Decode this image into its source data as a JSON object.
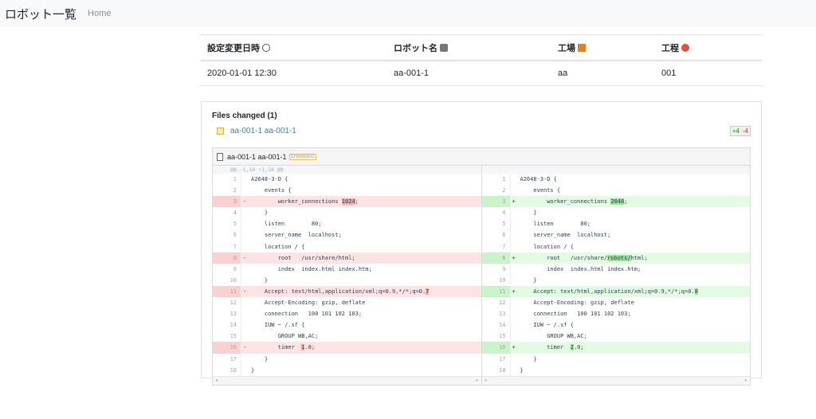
{
  "navbar": {
    "brand": "ロボット一覧",
    "home": "Home"
  },
  "info_table": {
    "headers": [
      {
        "label": "設定変更日時",
        "icon": "clock-icon"
      },
      {
        "label": "ロボット名",
        "icon": "robot-icon"
      },
      {
        "label": "工場",
        "icon": "factory-icon"
      },
      {
        "label": "工程",
        "icon": "warning-icon"
      }
    ],
    "row": [
      "2020-01-01 12:30",
      "aa-001-1",
      "aa",
      "001"
    ]
  },
  "files": {
    "title": "Files changed (1)",
    "file_link": "aa-001-1 aa-001-1",
    "added": "+4",
    "removed": "-4"
  },
  "diff": {
    "file_name": "aa-001-1 aa-001-1",
    "badge": "CHANGED",
    "hunk": "@@ -1,18 +1,18 @@",
    "left": [
      {
        "n": "1",
        "s": "",
        "t": "A2648-3-D {",
        "k": ""
      },
      {
        "n": "2",
        "s": "",
        "t": "    events {",
        "k": ""
      },
      {
        "n": "3",
        "s": "-",
        "t": "        worker_connections ",
        "h": "1024",
        "r": ";",
        "k": "del"
      },
      {
        "n": "4",
        "s": "",
        "t": "    }",
        "k": ""
      },
      {
        "n": "5",
        "s": "",
        "t": "    listen        80;",
        "k": ""
      },
      {
        "n": "6",
        "s": "",
        "t": "    server_name  localhost;",
        "k": ""
      },
      {
        "n": "7",
        "s": "",
        "t": "    location / {",
        "k": ""
      },
      {
        "n": "8",
        "s": "-",
        "t": "        root   /usr/share/html;",
        "k": "del"
      },
      {
        "n": "9",
        "s": "",
        "t": "        index  index.html index.htm;",
        "k": ""
      },
      {
        "n": "10",
        "s": "",
        "t": "    }",
        "k": ""
      },
      {
        "n": "11",
        "s": "-",
        "t": "    Accept: text/html,application/xml;q=0.9,*/*;q=0.",
        "h": "7",
        "r": "",
        "k": "del"
      },
      {
        "n": "12",
        "s": "",
        "t": "    Accept-Encoding: gzip, deflate",
        "k": ""
      },
      {
        "n": "13",
        "s": "",
        "t": "    connection   100 101 102 103;",
        "k": ""
      },
      {
        "n": "14",
        "s": "",
        "t": "    IUW ~ /.sf {",
        "k": ""
      },
      {
        "n": "15",
        "s": "",
        "t": "        GROUP WB,AC;",
        "k": ""
      },
      {
        "n": "16",
        "s": "-",
        "t": "        timer  ",
        "h": "1",
        "r": ".0;",
        "k": "del"
      },
      {
        "n": "17",
        "s": "",
        "t": "    }",
        "k": ""
      },
      {
        "n": "18",
        "s": "",
        "t": "}",
        "k": ""
      }
    ],
    "right": [
      {
        "n": "1",
        "s": "",
        "t": "A2648-3-D {",
        "k": ""
      },
      {
        "n": "2",
        "s": "",
        "t": "    events {",
        "k": ""
      },
      {
        "n": "3",
        "s": "+",
        "t": "        worker_connections ",
        "h": "2048",
        "r": ";",
        "k": "add"
      },
      {
        "n": "4",
        "s": "",
        "t": "    }",
        "k": ""
      },
      {
        "n": "5",
        "s": "",
        "t": "    listen        80;",
        "k": ""
      },
      {
        "n": "6",
        "s": "",
        "t": "    server_name  localhost;",
        "k": ""
      },
      {
        "n": "7",
        "s": "",
        "t": "    location / {",
        "k": ""
      },
      {
        "n": "8",
        "s": "+",
        "t": "        root   /usr/share/",
        "h": "robots/",
        "r": "html;",
        "k": "add"
      },
      {
        "n": "9",
        "s": "",
        "t": "        index  index.html index.htm;",
        "k": ""
      },
      {
        "n": "10",
        "s": "",
        "t": "    }",
        "k": ""
      },
      {
        "n": "11",
        "s": "+",
        "t": "    Accept: text/html,application/xml;q=0.9,*/*;q=0.",
        "h": "8",
        "r": "",
        "k": "add"
      },
      {
        "n": "12",
        "s": "",
        "t": "    Accept-Encoding: gzip, deflate",
        "k": ""
      },
      {
        "n": "13",
        "s": "",
        "t": "    connection   100 101 102 103;",
        "k": ""
      },
      {
        "n": "14",
        "s": "",
        "t": "    IUW ~ /.sf {",
        "k": ""
      },
      {
        "n": "15",
        "s": "",
        "t": "        GROUP WB,AC;",
        "k": ""
      },
      {
        "n": "16",
        "s": "+",
        "t": "        timer  ",
        "h": "2",
        "r": ".0;",
        "k": "add"
      },
      {
        "n": "17",
        "s": "",
        "t": "    }",
        "k": ""
      },
      {
        "n": "18",
        "s": "",
        "t": "}",
        "k": ""
      }
    ]
  }
}
